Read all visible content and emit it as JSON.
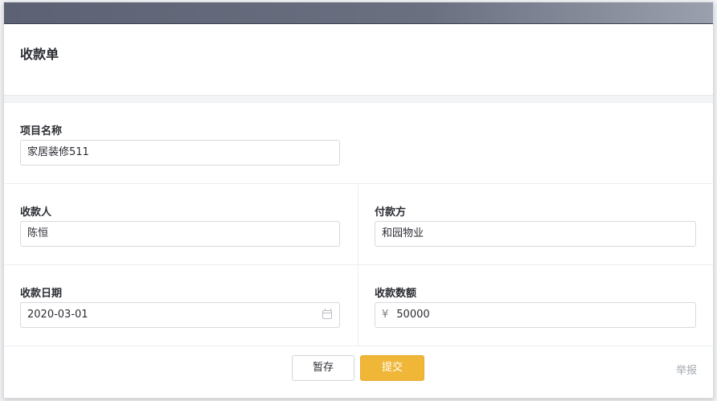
{
  "form": {
    "title": "收款单",
    "project_name": {
      "label": "项目名称",
      "value": "家居装修511"
    },
    "payee": {
      "label": "收款人",
      "value": "陈恒"
    },
    "payer": {
      "label": "付款方",
      "value": "和园物业"
    },
    "date": {
      "label": "收款日期",
      "value": "2020-03-01",
      "icon": "calendar-icon"
    },
    "amount": {
      "label": "收款数额",
      "currency": "¥",
      "value": "50000"
    }
  },
  "footer": {
    "save_label": "暂存",
    "submit_label": "提交",
    "report_label": "举报"
  },
  "colors": {
    "submit_bg": "#efb637",
    "topbar": "#5c6173"
  }
}
